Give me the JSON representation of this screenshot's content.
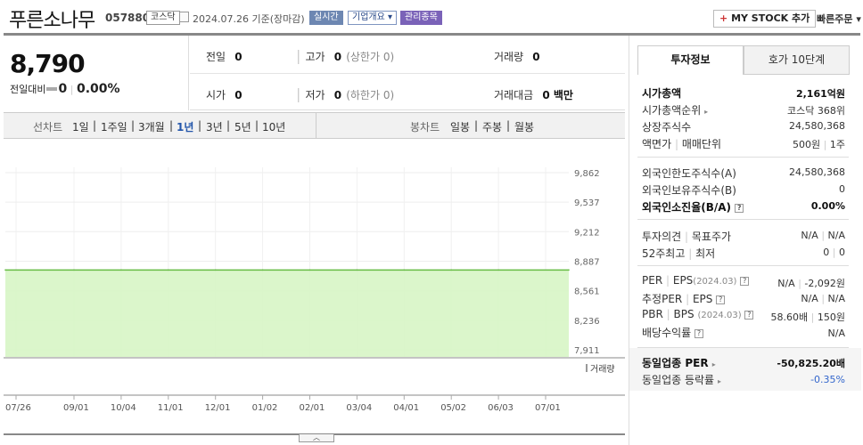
{
  "header": {
    "name": "푸른소나무",
    "code": "057880",
    "market_tag": "코스닥",
    "date": "2024.07.26",
    "date_basis": "기준(장마감)",
    "realtime_tag": "실시간",
    "company_info_tag": "기업개요",
    "managed_tag": "관리종목",
    "my_stock_label": "MY STOCK 추가",
    "quick_order_label": "빠른주문"
  },
  "quote": {
    "price": "8,790",
    "change_label": "전일대비",
    "change_value": "0",
    "change_pct": "0.00%",
    "prev_label": "전일",
    "prev_value": "0",
    "high_label": "고가",
    "high_value": "0",
    "high_limit": "(상한가 0)",
    "volume_label": "거래량",
    "volume_value": "0",
    "open_label": "시가",
    "open_value": "0",
    "low_label": "저가",
    "low_value": "0",
    "low_limit": "(하한가 0)",
    "amount_label": "거래대금",
    "amount_value": "0 백만"
  },
  "chart_tabs": {
    "line_label": "선차트",
    "periods": [
      "1일",
      "1주일",
      "3개월",
      "1년",
      "3년",
      "5년",
      "10년"
    ],
    "selected": "1년",
    "candle_label": "봉차트",
    "candles": [
      "일봉",
      "주봉",
      "월봉"
    ]
  },
  "chart_data": {
    "type": "area",
    "x": [
      "07/26",
      "09/01",
      "10/04",
      "11/01",
      "12/01",
      "01/02",
      "02/01",
      "03/04",
      "04/01",
      "05/02",
      "06/03",
      "07/01"
    ],
    "values": [
      8790,
      8790,
      8790,
      8790,
      8790,
      8790,
      8790,
      8790,
      8790,
      8790,
      8790,
      8790
    ],
    "yticks": [
      "9,862",
      "9,537",
      "9,212",
      "8,887",
      "8,561",
      "8,236",
      "7,911"
    ],
    "ylim": [
      7911,
      9862
    ],
    "volume_label": "거래량",
    "line_color": "#66bb44",
    "fill_color": "#d7f5c5"
  },
  "right_tabs": {
    "invest": "투자정보",
    "hoga": "호가 10단계"
  },
  "info": {
    "mcap_label": "시가총액",
    "mcap_value": "2,161억원",
    "mcap_rank_label": "시가총액순위",
    "mcap_rank_value": "코스닥 368위",
    "shares_label": "상장주식수",
    "shares_value": "24,580,368",
    "par_label": "액면가",
    "unit_label": "매매단위",
    "par_value": "500원",
    "unit_value": "1주",
    "foreign_limit_label": "외국인한도주식수(A)",
    "foreign_limit_value": "24,580,368",
    "foreign_hold_label": "외국인보유주식수(B)",
    "foreign_hold_value": "0",
    "foreign_ratio_label": "외국인소진율(B/A)",
    "foreign_ratio_value": "0.00%",
    "opinion_label": "투자의견",
    "target_label": "목표주가",
    "opinion_value": "N/A",
    "target_value": "N/A",
    "week52_high_label": "52주최고",
    "week52_low_label": "최저",
    "week52_high_value": "0",
    "week52_low_value": "0",
    "per_label": "PER",
    "eps_label": "EPS",
    "eps_period": "(2024.03)",
    "per_value": "N/A",
    "eps_value": "-2,092원",
    "est_per_label": "추정PER",
    "est_eps_label": "EPS",
    "est_per_value": "N/A",
    "est_eps_value": "N/A",
    "pbr_label": "PBR",
    "bps_label": "BPS",
    "bps_period": "(2024.03)",
    "pbr_value": "58.60배",
    "bps_value": "150원",
    "div_label": "배당수익률",
    "div_value": "N/A",
    "ind_per_label": "동일업종 PER",
    "ind_per_value": "-50,825.20배",
    "ind_chg_label": "동일업종 등락률",
    "ind_chg_value": "-0.35%"
  }
}
